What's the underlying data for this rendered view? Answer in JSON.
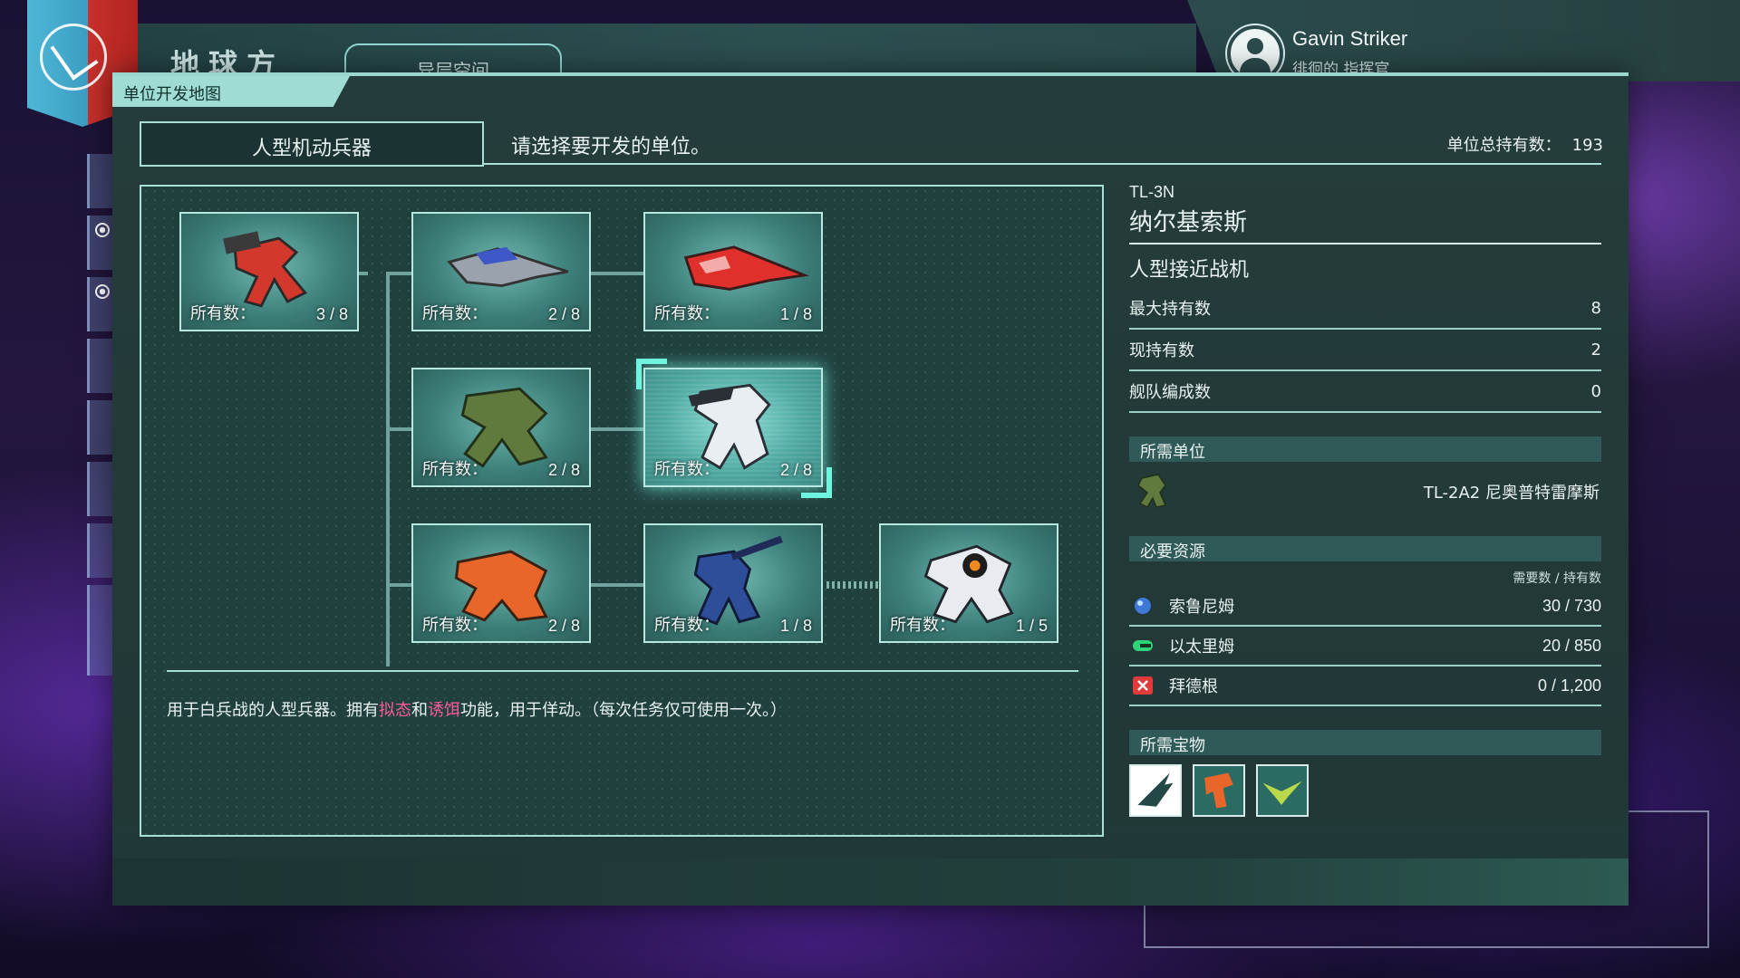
{
  "header": {
    "faction_title": "地球方",
    "space_tab": "异层空间",
    "player_name": "Gavin Striker",
    "player_rank": "徘徊的 指挥官"
  },
  "panel": {
    "tab_title": "单位开发地图",
    "category": "人型机动兵器",
    "instruction": "请选择要开发的单位。",
    "total_owned_label": "单位总持有数：",
    "total_owned_value": "193"
  },
  "tree": {
    "owned_label": "所有数：",
    "units": [
      {
        "id": "u1",
        "count": "3 / 8",
        "color": "#d2382c"
      },
      {
        "id": "u2",
        "count": "2 / 8",
        "color": "#3f58c8"
      },
      {
        "id": "u3",
        "count": "1 / 8",
        "color": "#e0302c"
      },
      {
        "id": "u4",
        "count": "2 / 8",
        "color": "#5f7a3c"
      },
      {
        "id": "u5",
        "count": "2 / 8",
        "color": "#e9eef2",
        "selected": true
      },
      {
        "id": "u6",
        "count": "2 / 8",
        "color": "#e8662a"
      },
      {
        "id": "u7",
        "count": "1 / 8",
        "color": "#2f4e9a"
      },
      {
        "id": "u8",
        "count": "1 / 5",
        "color": "#e8ecf0"
      }
    ],
    "description_before": "用于白兵战的人型兵器。拥有",
    "description_hl1": "拟态",
    "description_mid": "和",
    "description_hl2": "诱饵",
    "description_after": "功能，用于佯动。（每次任务仅可使用一次。）"
  },
  "detail": {
    "code": "TL-3N",
    "name": "纳尔基索斯",
    "type": "人型接近战机",
    "stats": [
      {
        "label": "最大持有数",
        "value": "8"
      },
      {
        "label": "现持有数",
        "value": "2"
      },
      {
        "label": "舰队编成数",
        "value": "0"
      }
    ],
    "required_unit_heading": "所需单位",
    "required_unit_name": "TL-2A2  尼奥普特雷摩斯",
    "resources_heading": "必要资源",
    "resources_caption": "需要数 / 持有数",
    "resources": [
      {
        "name": "索鲁尼姆",
        "value": "30 / 730",
        "icon": "solnium-icon",
        "color": "#3e78d8"
      },
      {
        "name": "以太里姆",
        "value": "20 / 850",
        "icon": "etherium-icon",
        "color": "#2fd47a"
      },
      {
        "name": "拜德根",
        "value": "0 / 1,200",
        "icon": "baidegen-icon",
        "color": "#e03a3a"
      }
    ],
    "treasures_heading": "所需宝物"
  },
  "colors": {
    "accent": "#a9ded6",
    "panel_bg": "#243c3b",
    "highlight_text": "#ff5a9a"
  }
}
